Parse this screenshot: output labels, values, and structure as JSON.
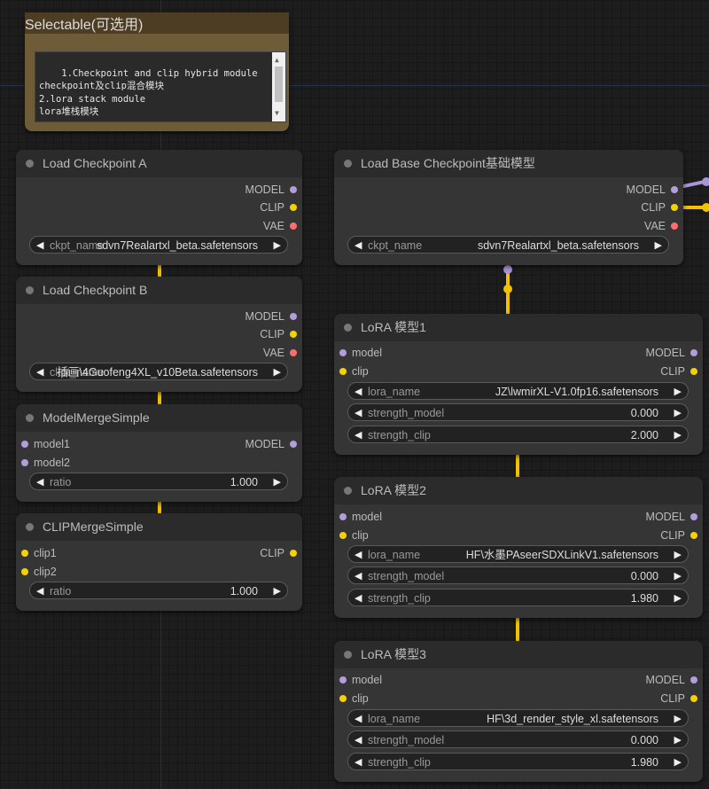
{
  "note": {
    "title": "Selectable(可选用)",
    "text": "1.Checkpoint and clip hybrid module\ncheckpoint及clip混合模块\n2.lora stack module\nlora堆栈模块"
  },
  "nodes": {
    "ckptA": {
      "title": "Load Checkpoint A",
      "outputs": [
        "MODEL",
        "CLIP",
        "VAE"
      ],
      "widget_label": "ckpt_name",
      "widget_value": "sdvn7Realartxl_beta.safetensors"
    },
    "ckptB": {
      "title": "Load Checkpoint B",
      "outputs": [
        "MODEL",
        "CLIP",
        "VAE"
      ],
      "widget_label": "ckpt_name",
      "widget_value": "插画\\4Guofeng4XL_v10Beta.safetensors"
    },
    "mergeModel": {
      "title": "ModelMergeSimple",
      "inputs": [
        "model1",
        "model2"
      ],
      "output": "MODEL",
      "widget_label": "ratio",
      "widget_value": "1.000"
    },
    "mergeClip": {
      "title": "CLIPMergeSimple",
      "inputs": [
        "clip1",
        "clip2"
      ],
      "output": "CLIP",
      "widget_label": "ratio",
      "widget_value": "1.000"
    },
    "baseCkpt": {
      "title": "Load Base Checkpoint基础模型",
      "outputs": [
        "MODEL",
        "CLIP",
        "VAE"
      ],
      "widget_label": "ckpt_name",
      "widget_value": "sdvn7Realartxl_beta.safetensors"
    },
    "lora1": {
      "title": "LoRA 模型1",
      "inputs": [
        "model",
        "clip"
      ],
      "outputs": [
        "MODEL",
        "CLIP"
      ],
      "lora_label": "lora_name",
      "lora_value": "JZ\\lwmirXL-V1.0fp16.safetensors",
      "sm_label": "strength_model",
      "sm_value": "0.000",
      "sc_label": "strength_clip",
      "sc_value": "2.000"
    },
    "lora2": {
      "title": "LoRA 模型2",
      "inputs": [
        "model",
        "clip"
      ],
      "outputs": [
        "MODEL",
        "CLIP"
      ],
      "lora_label": "lora_name",
      "lora_value": "HF\\水墨PAseerSDXLinkV1.safetensors",
      "sm_label": "strength_model",
      "sm_value": "0.000",
      "sc_label": "strength_clip",
      "sc_value": "1.980"
    },
    "lora3": {
      "title": "LoRA 模型3",
      "inputs": [
        "model",
        "clip"
      ],
      "outputs": [
        "MODEL",
        "CLIP"
      ],
      "lora_label": "lora_name",
      "lora_value": "HF\\3d_render_style_xl.safetensors",
      "sm_label": "strength_model",
      "sm_value": "0.000",
      "sc_label": "strength_clip",
      "sc_value": "1.980"
    }
  },
  "colors": {
    "model_port": "#b39ddb",
    "clip_port": "#f6d100",
    "vae_port": "#ff6e6e",
    "wire_clip": "#f2c200",
    "wire_model": "#a995d8"
  }
}
